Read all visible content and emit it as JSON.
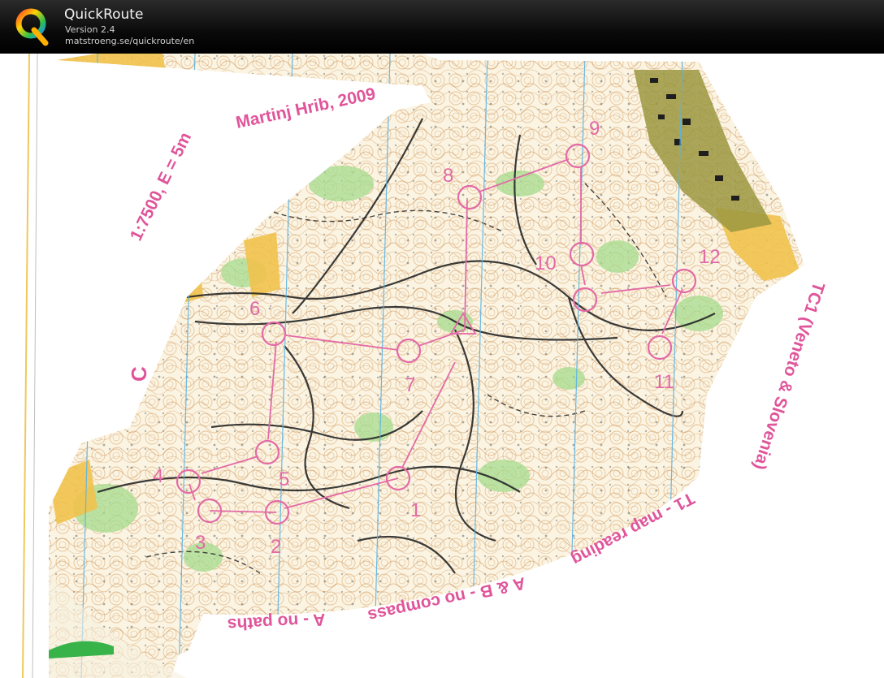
{
  "app": {
    "name": "QuickRoute",
    "version": "Version 2.4",
    "url": "matstroeng.se/quickroute/en"
  },
  "map": {
    "author_text": "Martinj Hrib, 2009",
    "scale_text": "1:7500, E = 5m",
    "course_letter": "C",
    "event_text": "TC1 (Veneto & Slovenia)",
    "exercise_text": "T1 - map reading",
    "part_ab_text": "A & B - no compass",
    "part_a_text": "A - no paths",
    "control_numbers": [
      "1",
      "2",
      "3",
      "4",
      "5",
      "6",
      "7",
      "8",
      "9",
      "10",
      "11",
      "12"
    ],
    "colors": {
      "course": "#e36aa6",
      "forest_white": "#fbf6ea",
      "open_yellow": "#f3c64a",
      "green": "#9fd88a",
      "contour": "#c8884a",
      "track": "#2b2b2b",
      "water_blue": "#5ab4e6"
    }
  }
}
